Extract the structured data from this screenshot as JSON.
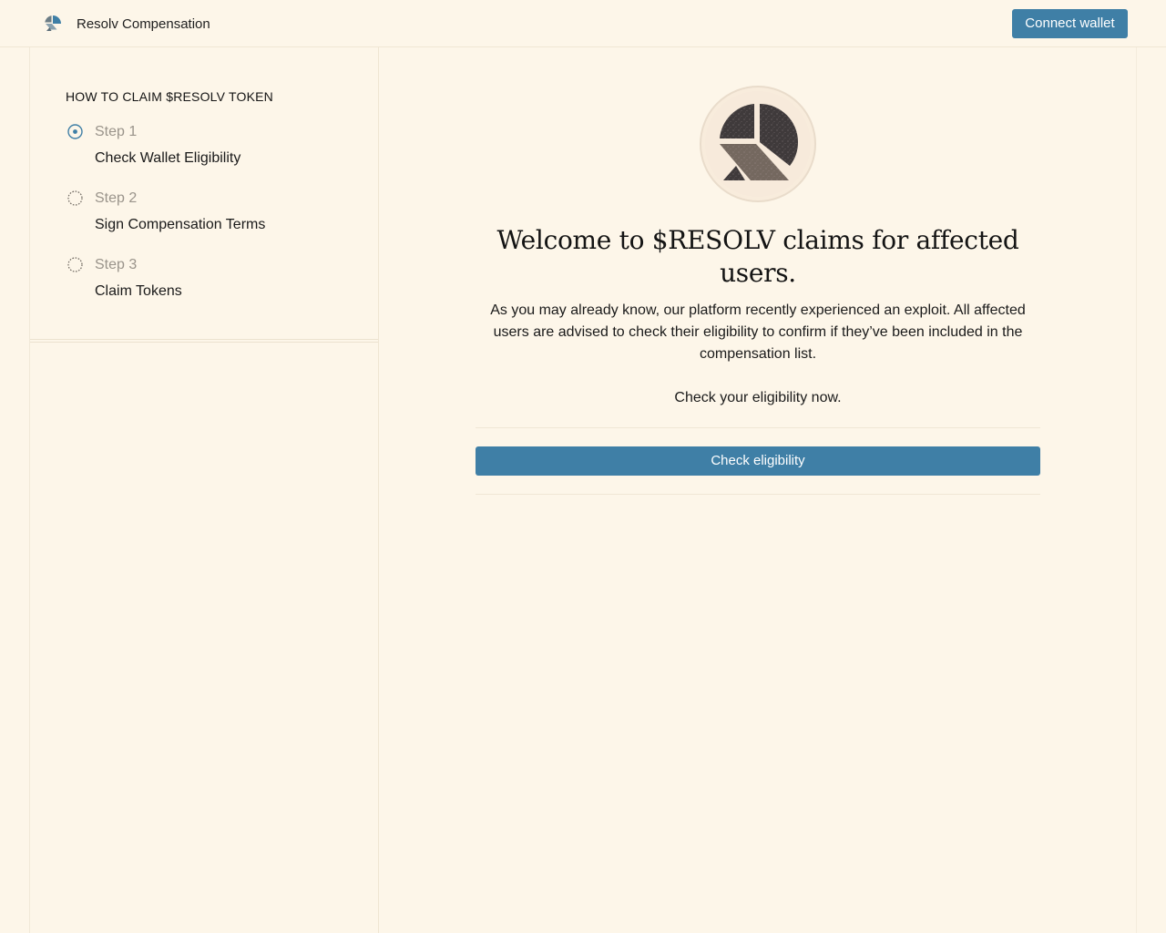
{
  "header": {
    "brand_name": "Resolv Compensation",
    "logo_icon": "resolv-logo-icon",
    "connect_label": "Connect wallet"
  },
  "sidebar": {
    "title": "HOW TO CLAIM $RESOLV TOKEN",
    "steps": [
      {
        "label": "Step 1",
        "title": "Check Wallet Eligibility",
        "status": "active",
        "icon": "radio-active-icon"
      },
      {
        "label": "Step 2",
        "title": "Sign Compensation Terms",
        "status": "pending",
        "icon": "radio-dashed-icon"
      },
      {
        "label": "Step 3",
        "title": "Claim Tokens",
        "status": "pending",
        "icon": "radio-dashed-icon"
      }
    ]
  },
  "main": {
    "hero_icon": "resolv-logo-icon",
    "title": "Welcome to $RESOLV claims for affected users.",
    "description": "As you may already know, our platform recently experienced an exploit. All affected users are advised to check their eligibility to confirm if they’ve been included in the compensation list.",
    "cta_text": "Check your eligibility now.",
    "check_label": "Check eligibility"
  },
  "colors": {
    "background": "#fdf6e9",
    "accent": "#3f7fa6",
    "text": "#1a1a1a",
    "muted": "#9a948b"
  }
}
